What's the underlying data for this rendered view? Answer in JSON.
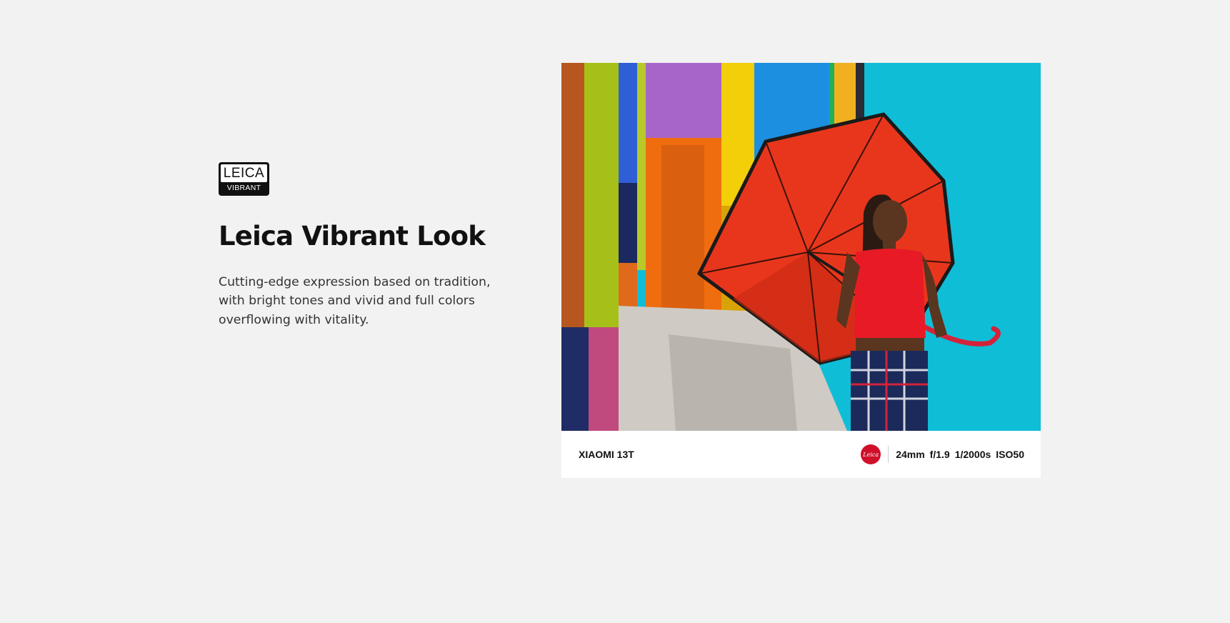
{
  "badge": {
    "brand": "LEICA",
    "style": "VIBRANT"
  },
  "title": "Leica Vibrant Look",
  "description": "Cutting-edge expression based on tradition, with bright tones and vivid and full colors overflowing with vitality.",
  "photo": {
    "subject": "woman holding red umbrella in front of colorful pillars"
  },
  "watermark": {
    "camera_model": "XIAOMI 13T",
    "logo_text": "Leica",
    "focal_length": "24mm",
    "aperture": "f/1.9",
    "shutter": "1/2000s",
    "iso": "ISO50"
  },
  "colors": {
    "background": "#f2f2f2",
    "leica_red": "#d0102a",
    "umbrella_red": "#e8361c",
    "wall_cyan": "#10bdd6"
  }
}
